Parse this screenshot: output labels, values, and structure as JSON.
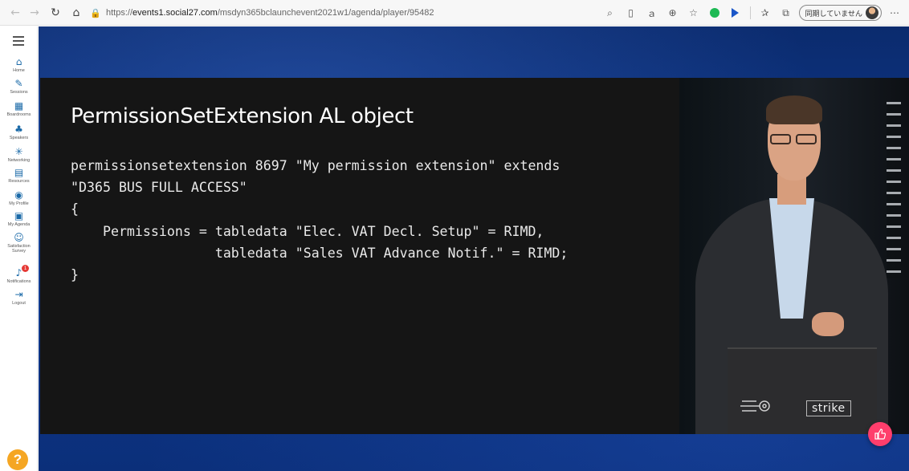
{
  "browser": {
    "url_prefix": "https://",
    "url_host": "events1.social27.com",
    "url_path": "/msdyn365bclaunchevent2021w1/agenda/player/95482",
    "sync_label": "同期していません"
  },
  "sidebar": {
    "items": [
      {
        "label": "Home",
        "icon": "home-icon"
      },
      {
        "label": "Sessions",
        "icon": "pencil-icon"
      },
      {
        "label": "Boardrooms",
        "icon": "boardroom-icon"
      },
      {
        "label": "Speakers",
        "icon": "speaker-icon"
      },
      {
        "label": "Networking",
        "icon": "networking-icon"
      },
      {
        "label": "Resources",
        "icon": "resources-icon"
      },
      {
        "label": "My Profile",
        "icon": "profile-icon"
      },
      {
        "label": "My Agenda",
        "icon": "calendar-icon"
      },
      {
        "label": "Satisfaction Survey",
        "icon": "survey-icon"
      },
      {
        "label": "Notifications",
        "icon": "bell-icon"
      },
      {
        "label": "Logout",
        "icon": "logout-icon"
      }
    ],
    "notification_count": "1",
    "help_label": "?"
  },
  "slide": {
    "title": "PermissionSetExtension AL object",
    "code_lines": [
      "permissionsetextension 8697 \"My permission extension\" extends",
      "\"D365 BUS FULL ACCESS\"",
      "{",
      "    Permissions = tabledata \"Elec. VAT Decl. Setup\" = RIMD,",
      "                  tabledata \"Sales VAT Advance Notif.\" = RIMD;",
      "}"
    ]
  },
  "video": {
    "brand": "strike"
  },
  "colors": {
    "stage_blue": "#0f3a8f",
    "slide_bg": "#151515",
    "like_pink": "#ff3e6c",
    "help_orange": "#f5a623",
    "sidebar_icon": "#1b6aa8"
  }
}
